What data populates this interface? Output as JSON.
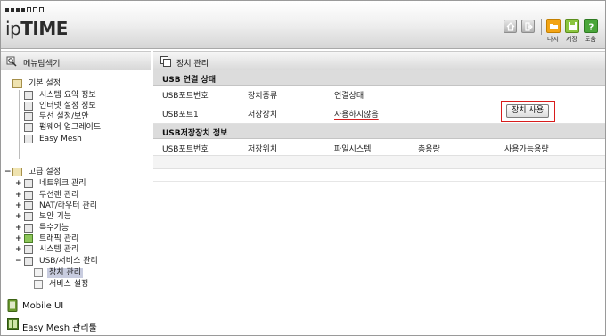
{
  "brand": {
    "prefix": "ip",
    "name": "TIME"
  },
  "header": {
    "buttons": [
      {
        "name": "home",
        "label": ""
      },
      {
        "name": "logout",
        "label": ""
      },
      {
        "name": "folder",
        "label": "다시"
      },
      {
        "name": "save",
        "label": "저장"
      },
      {
        "name": "help",
        "label": "도움"
      }
    ]
  },
  "sidebar": {
    "title": "메뉴탐색기",
    "basic": {
      "label": "기본 설정",
      "items": [
        "시스템 요약 정보",
        "인터넷 설정 정보",
        "무선 설정/보안",
        "펌웨어 업그레이드",
        "Easy Mesh"
      ]
    },
    "advanced": {
      "label": "고급 설정",
      "items": [
        "네트워크 관리",
        "무선랜 관리",
        "NAT/라우터 관리",
        "보안 기능",
        "특수기능",
        "트래픽 관리",
        "시스템 관리",
        "USB/서비스 관리"
      ],
      "usb_children": [
        "장치 관리",
        "서비스 설정"
      ]
    },
    "bottom": [
      "Mobile UI",
      "Easy Mesh 관리툴"
    ]
  },
  "main": {
    "title": "장치 관리",
    "usb_status": {
      "section": "USB 연결 상태",
      "headers": [
        "USB포트번호",
        "장치종류",
        "연결상태"
      ],
      "rows": [
        {
          "port": "USB포트1",
          "type": "저장장치",
          "status": "사용하지않음",
          "action": "장치 사용"
        }
      ]
    },
    "usb_storage": {
      "section": "USB저장장치 정보",
      "headers": [
        "USB포트번호",
        "저장위치",
        "파일시스템",
        "총용량",
        "사용가능용량"
      ]
    }
  },
  "colors": {
    "accent_red": "#d81c1c",
    "selected_bg": "#c8ccdf"
  }
}
